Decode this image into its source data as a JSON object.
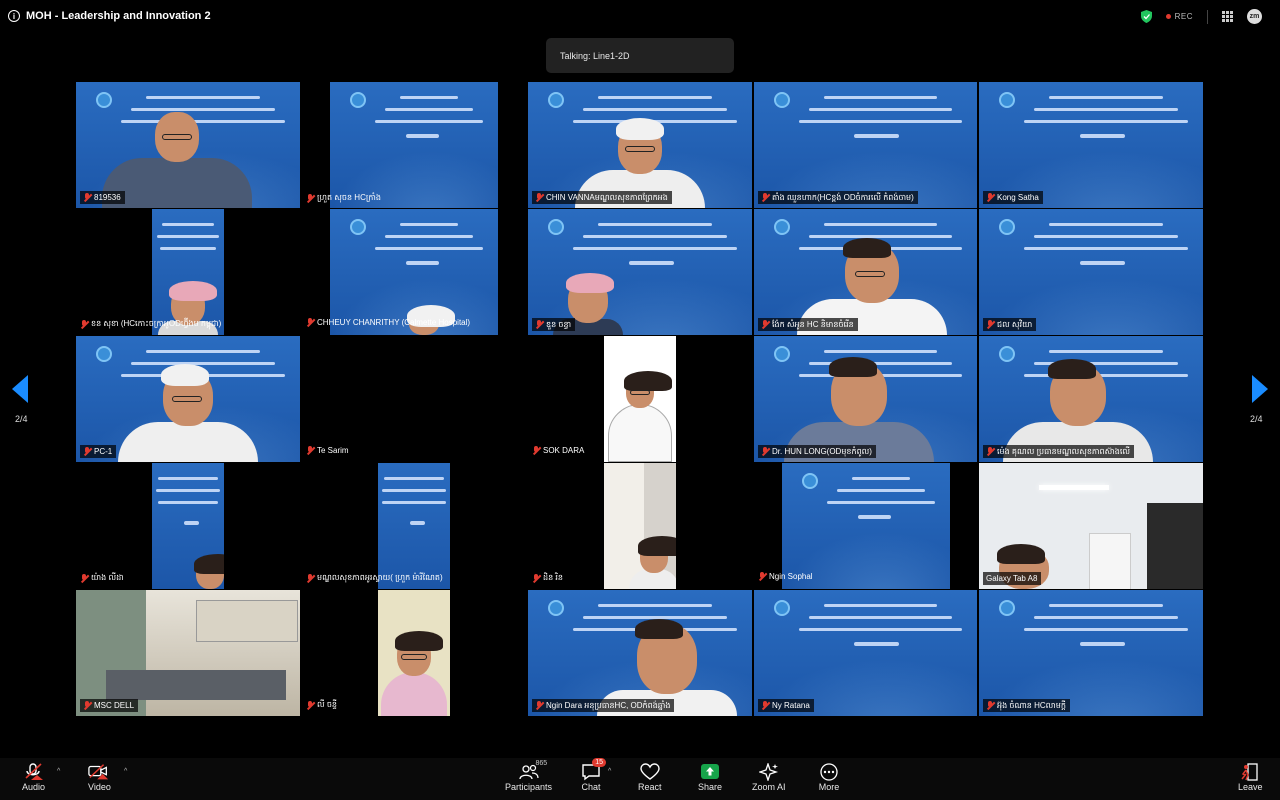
{
  "meeting": {
    "title": "MOH - Leadership and Innovation 2",
    "rec_label": "REC",
    "avatar_initials": "zm"
  },
  "talking": "Talking: Line1-2D",
  "pagination": {
    "left": "2/4",
    "right": "2/4"
  },
  "tiles": {
    "t1": "819536",
    "t2": "ហ្រួត សុចន HCក្រាំង",
    "t3": "CHIN VANNAមណ្ឌលសុខភាពព្រែកអង",
    "t4": "តាំង ឈួនហាក(HCខ្ពង់ OD​ចំការលើ កំពង់ចាម)",
    "t5": "Kong Satha",
    "t6": "ខន សុខា (HCកោះចក្រាអូODហ្វ៊ីងម កម្ពុជា)",
    "t7": "CHHEUY CHANRITHY (Calmette Hospital)",
    "t8": "ឌួន ចន្ធា",
    "t9": "ង៉ែក សំអូន HC និមានចំរើន",
    "t10": "ជល សុវិយា",
    "t11": "PC-1",
    "t12": "Te Sarim",
    "t13": "SOK DARA",
    "t14": "Dr. HUN LONG(ODមុខកំពូល)",
    "t15": "ម៉េង គុណល ប្រធានមណ្ឌលសុខភាពស៊ាងលើ",
    "t16": "យ៉ាង លីដា",
    "t17": "មណ្ឌលសុខភាពអូរស្វាយ( ហ្រួក ម៉ារីណែត)",
    "t18": "ដិន រិន",
    "t19": "Ngin Sophal",
    "t20": "Galaxy Tab A8",
    "t21": "MSC DELL",
    "t22": "លី ចន្ទី",
    "t23": "Ngin Dara អនុប្រធានHC, ODកំពង់ឆ្នាំង",
    "t24": "Ny Ratana",
    "t25": "អ៊ុង ចំណាន HCលាមក្តី"
  },
  "toolbar": {
    "audio": "Audio",
    "video": "Video",
    "participants": "Participants",
    "participants_count": "865",
    "chat": "Chat",
    "chat_badge": "15",
    "react": "React",
    "share": "Share",
    "zoom_ai": "Zoom AI",
    "more": "More",
    "leave": "Leave"
  },
  "colors": {
    "accent_green": "#22c55e",
    "muted_red": "#e03a2f",
    "slide_blue": "#1f5fae"
  }
}
